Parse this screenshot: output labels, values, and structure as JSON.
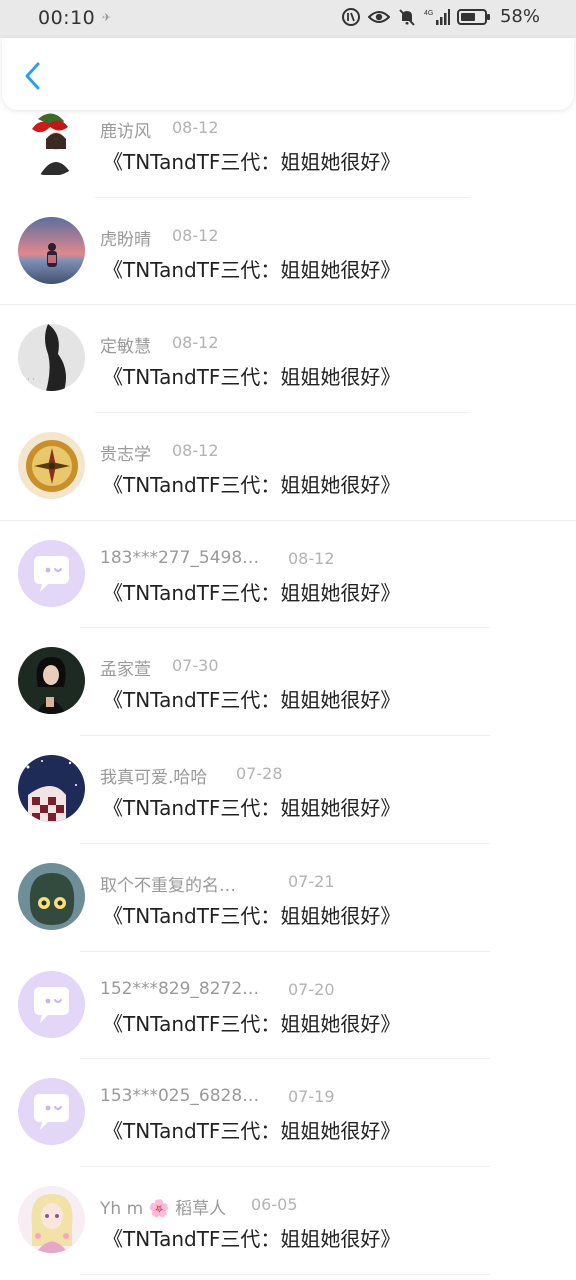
{
  "status_bar": {
    "time": "00:10",
    "small_indicator": "✈",
    "network": "4G",
    "battery": "58%"
  },
  "header": {
    "back_icon": "chevron-left-icon",
    "accent_color": "#2d9ff0"
  },
  "rows": [
    {
      "name": "鹿访风",
      "date": "08-12",
      "message": "《TNTandTF三代：姐姐她很好》",
      "avatar": "flower-portrait"
    },
    {
      "name": "虎盼晴",
      "date": "08-12",
      "message": "《TNTandTF三代：姐姐她很好》",
      "avatar": "sunset-person"
    },
    {
      "name": "定敏慧",
      "date": "08-12",
      "message": "《TNTandTF三代：姐姐她很好》",
      "avatar": "bw-silhouette"
    },
    {
      "name": "贵志学",
      "date": "08-12",
      "message": "《TNTandTF三代：姐姐她很好》",
      "avatar": "compass"
    },
    {
      "name": "183***277_5498…",
      "date": "08-12",
      "message": "《TNTandTF三代：姐姐她很好》",
      "avatar": "default-chat"
    },
    {
      "name": "孟家萱",
      "date": "07-30",
      "message": "《TNTandTF三代：姐姐她很好》",
      "avatar": "dark-girl"
    },
    {
      "name": "我真可爱.哈哈",
      "date": "07-28",
      "message": "《TNTandTF三代：姐姐她很好》",
      "avatar": "night-sky"
    },
    {
      "name": "取个不重复的名…",
      "date": "07-21",
      "message": "《TNTandTF三代：姐姐她很好》",
      "avatar": "cartoon-character"
    },
    {
      "name": "152***829_8272…",
      "date": "07-20",
      "message": "《TNTandTF三代：姐姐她很好》",
      "avatar": "default-chat"
    },
    {
      "name": "153***025_6828…",
      "date": "07-19",
      "message": "《TNTandTF三代：姐姐她很好》",
      "avatar": "default-chat"
    },
    {
      "name": "Yh m 🌸 稻草人",
      "date": "06-05",
      "message": "《TNTandTF三代：姐姐她很好》",
      "avatar": "anime-doll"
    }
  ]
}
